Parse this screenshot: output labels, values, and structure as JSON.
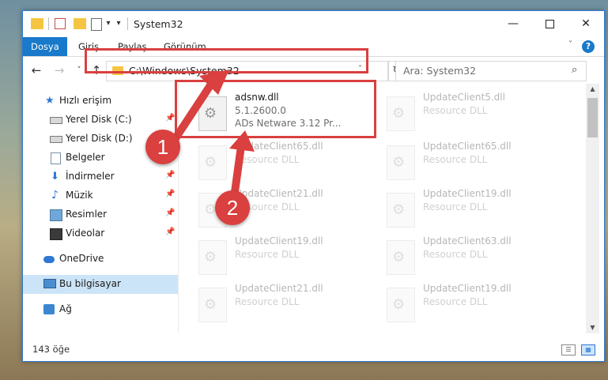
{
  "window": {
    "title": "System32",
    "controls": {
      "minimize": "—",
      "maximize": "",
      "close": "✕"
    }
  },
  "quick_access_toolbar": {
    "dropdown_caret": "▾",
    "customize": "▾"
  },
  "ribbon": {
    "tabs": [
      "Dosya",
      "Giriş",
      "Paylaş",
      "Görünüm"
    ],
    "active_tab": "Dosya",
    "collapse": "˅",
    "help": "?"
  },
  "navbar": {
    "back": "←",
    "forward": "→",
    "recent": "˅",
    "up": "↑",
    "address": "C:\\Windows\\System32",
    "address_dropdown": "˅",
    "refresh": "↻",
    "search_placeholder": "Ara: System32",
    "search_icon": "⌕"
  },
  "sidebar": {
    "items": [
      {
        "label": "Hızlı erişim",
        "icon": "star-icon",
        "pinned": false
      },
      {
        "label": "Yerel Disk (C:)",
        "icon": "drive-icon",
        "pinned": true
      },
      {
        "label": "Yerel Disk (D:)",
        "icon": "drive-icon",
        "pinned": false
      },
      {
        "label": "Belgeler",
        "icon": "documents-icon",
        "pinned": true
      },
      {
        "label": "İndirmeler",
        "icon": "download-icon",
        "pinned": true
      },
      {
        "label": "Müzik",
        "icon": "music-icon",
        "pinned": true
      },
      {
        "label": "Resimler",
        "icon": "pictures-icon",
        "pinned": true
      },
      {
        "label": "Videolar",
        "icon": "videos-icon",
        "pinned": true
      },
      {
        "label": "OneDrive",
        "icon": "onedrive-icon",
        "pinned": false
      },
      {
        "label": "Bu bilgisayar",
        "icon": "this-pc-icon",
        "pinned": false,
        "selected": true
      },
      {
        "label": "Ağ",
        "icon": "network-icon",
        "pinned": false
      }
    ],
    "pin_glyph": "📌"
  },
  "files": [
    {
      "name": "adsnw.dll",
      "version": "5.1.2600.0",
      "description": "ADs Netware 3.12 Pr..."
    },
    {
      "name": "UpdateClient5.dll",
      "description": "Resource DLL"
    },
    {
      "name": "UpdateClient65.dll",
      "description": "Resource DLL"
    },
    {
      "name": "UpdateClient65.dll",
      "description": "Resource DLL"
    },
    {
      "name": "UpdateClient21.dll",
      "description": "Resource DLL"
    },
    {
      "name": "UpdateClient19.dll",
      "description": "Resource DLL"
    },
    {
      "name": "UpdateClient19.dll",
      "description": "Resource DLL"
    },
    {
      "name": "UpdateClient63.dll",
      "description": "Resource DLL"
    },
    {
      "name": "UpdateClient21.dll",
      "description": "Resource DLL"
    },
    {
      "name": "UpdateClient19.dll",
      "description": "Resource DLL"
    }
  ],
  "status_bar": {
    "item_count": "143 öğe"
  },
  "annotations": {
    "step1": "1",
    "step2": "2",
    "color": "#d9403f"
  }
}
